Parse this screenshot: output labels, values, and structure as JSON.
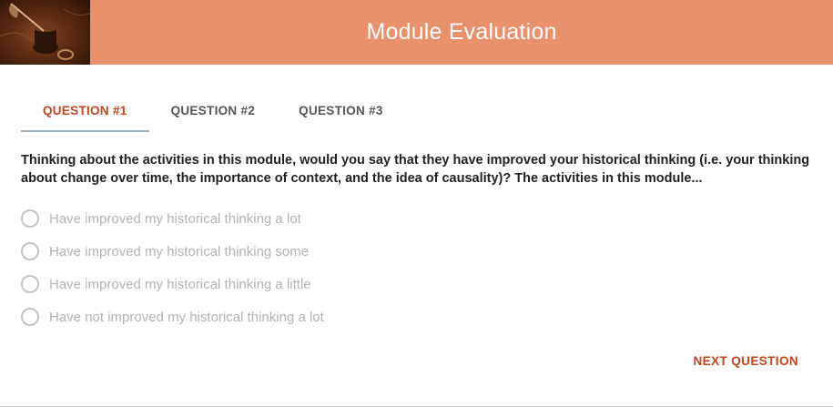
{
  "header": {
    "title": "Module Evaluation",
    "image_icon": "quill-and-inkwell-image",
    "background_color": "#e8916a"
  },
  "tabs": [
    {
      "label": "QUESTION #1",
      "active": true
    },
    {
      "label": "QUESTION #2",
      "active": false
    },
    {
      "label": "QUESTION #3",
      "active": false
    }
  ],
  "question": {
    "text": "Thinking about the activities in this module, would you say that they have improved your historical thinking (i.e. your thinking about change over time, the importance of context, and the idea of causality)? The activities in this module...",
    "options": [
      {
        "label": "Have improved my historical thinking a lot",
        "selected": false
      },
      {
        "label": "Have improved my historical thinking some",
        "selected": false
      },
      {
        "label": "Have improved my historical thinking a little",
        "selected": false
      },
      {
        "label": "Have not improved my historical thinking a lot",
        "selected": false
      }
    ]
  },
  "actions": {
    "next_label": "NEXT QUESTION"
  },
  "colors": {
    "accent": "#c8421a",
    "tab_indicator": "#9db3c9",
    "option_text": "#b4b4b4"
  }
}
